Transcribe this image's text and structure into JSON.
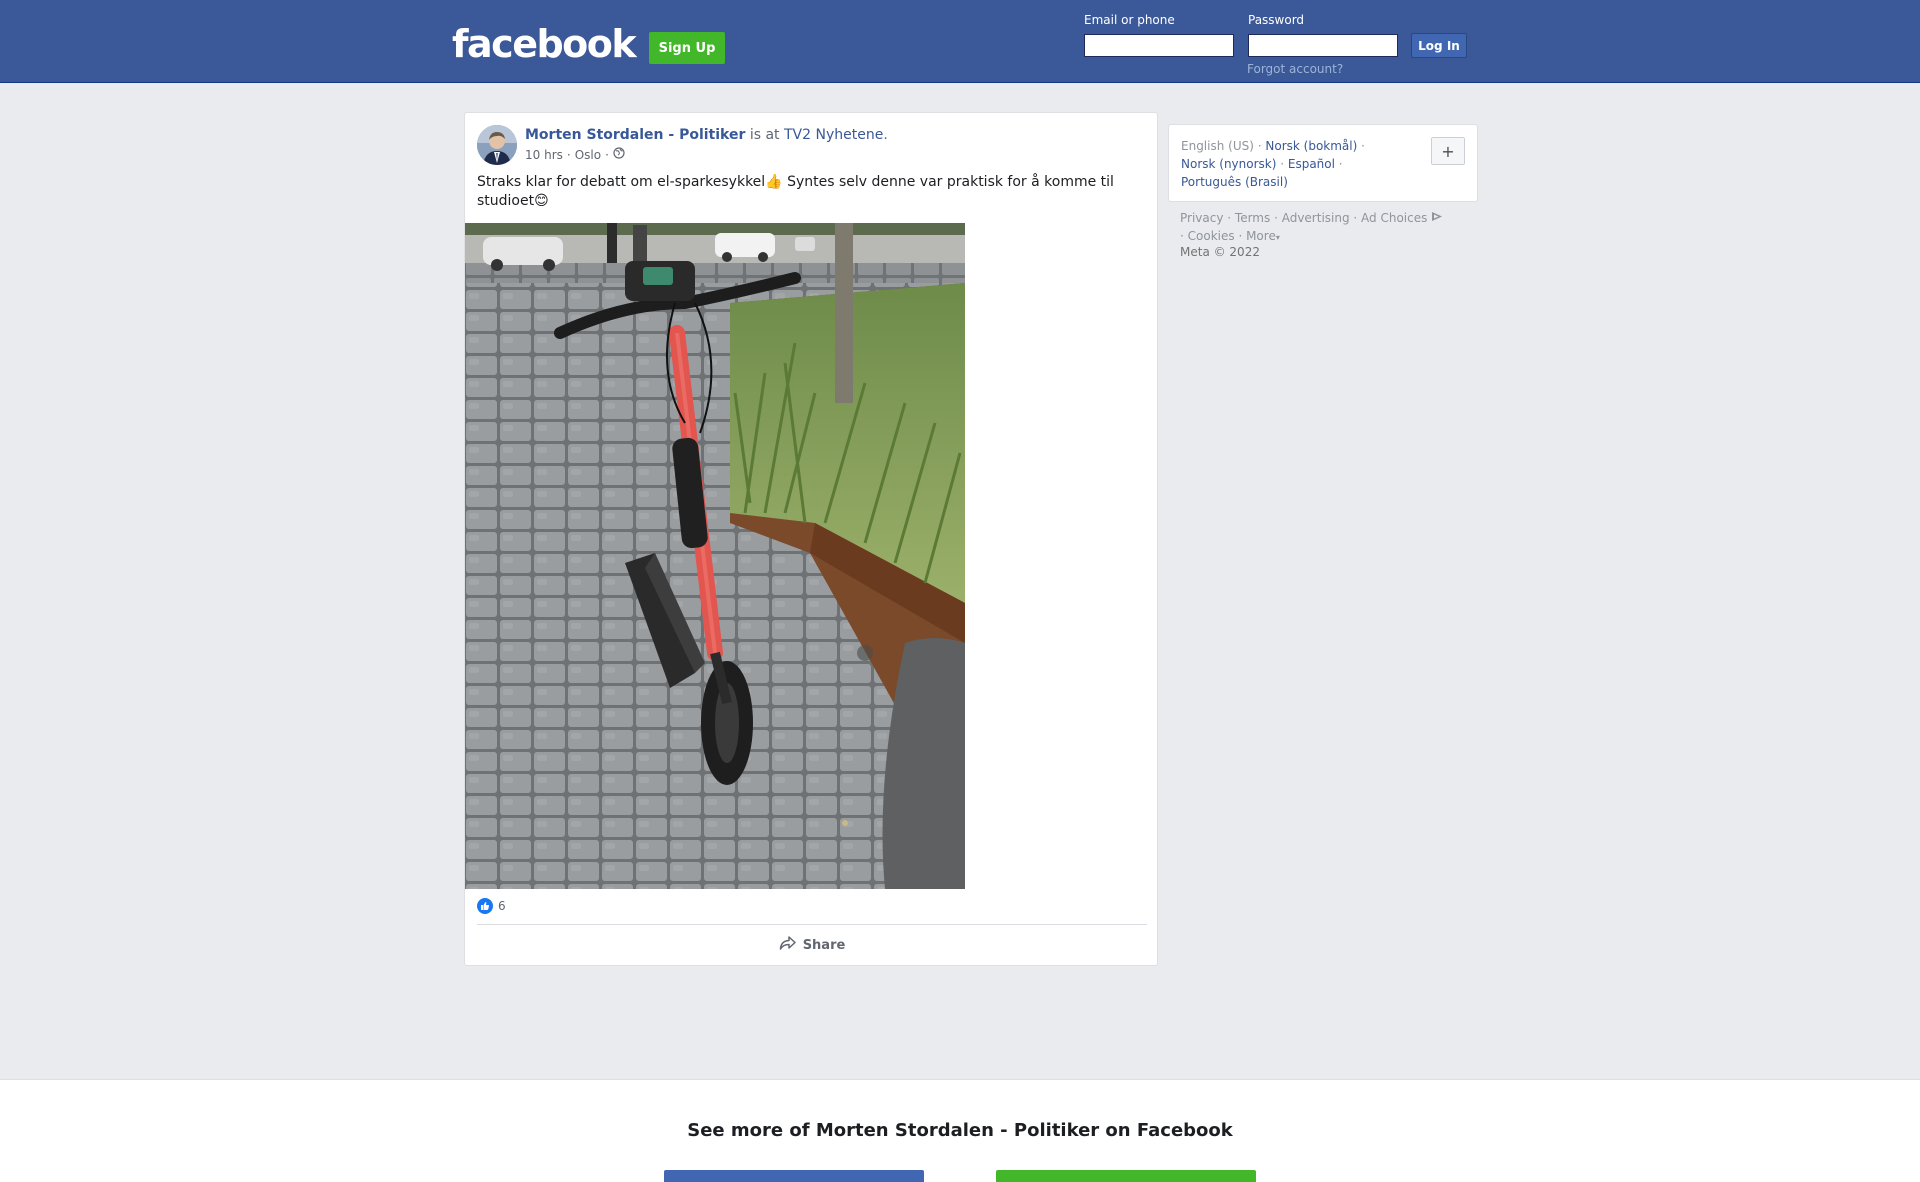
{
  "header": {
    "logo": "facebook",
    "signup_label": "Sign Up",
    "email_label": "Email or phone",
    "password_label": "Password",
    "login_label": "Log In",
    "forgot_label": "Forgot account?",
    "email_value": "",
    "password_value": ""
  },
  "post": {
    "author": "Morten Stordalen - Politiker",
    "is_at": "is at",
    "place": "TV2 Nyhetene",
    "period": ".",
    "time": "10 hrs",
    "location": "Oslo",
    "separator": "·",
    "text": "Straks klar for debatt om el-sparkesykkel👍 Syntes selv denne var praktisk for å komme til studioet😊",
    "likes": "6",
    "share_label": "Share"
  },
  "languages": {
    "current": "English (US)",
    "items": [
      "Norsk (bokmål)",
      "Norsk (nynorsk)",
      "Español",
      "Português (Brasil)"
    ],
    "plus": "+"
  },
  "footer": {
    "links": [
      "Privacy",
      "Terms",
      "Advertising",
      "Ad Choices",
      "Cookies",
      "More"
    ],
    "copyright": "Meta © 2022"
  },
  "bottom": {
    "title": "See more of Morten Stordalen - Politiker on Facebook"
  },
  "colors": {
    "header_bg": "#3b5998",
    "signup_green": "#42b72a",
    "link_blue": "#385898"
  }
}
